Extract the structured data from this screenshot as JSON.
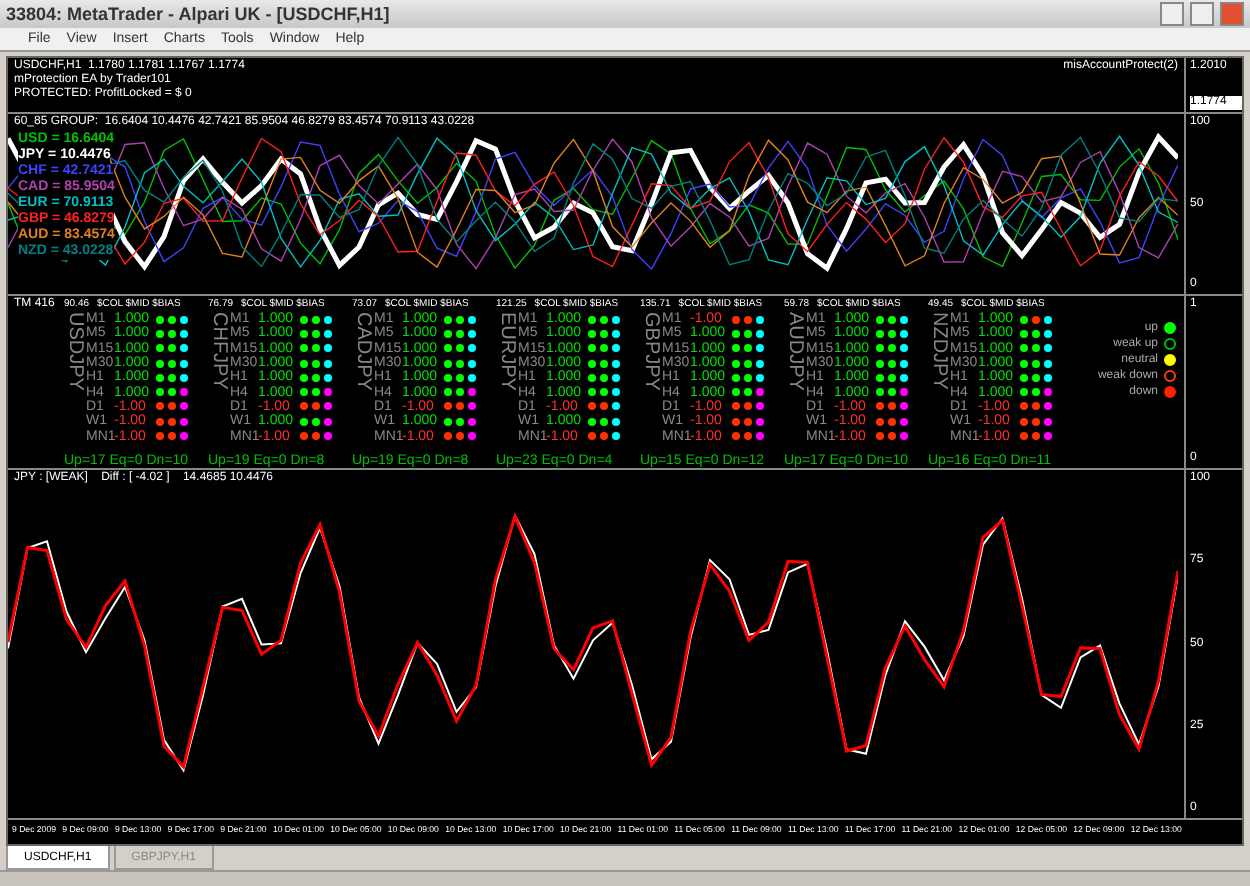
{
  "window": {
    "title": "33804: MetaTrader - Alpari UK - [USDCHF,H1]"
  },
  "menu": [
    "File",
    "View",
    "Insert",
    "Charts",
    "Tools",
    "Window",
    "Help"
  ],
  "price_panel": {
    "lines": [
      "USDCHF,H1  1.1780 1.1781 1.1767 1.1774",
      "mProtection EA by Trader101",
      "PROTECTED: ProfitLocked = $ 0"
    ],
    "indicator": "misAccountProtect(2)",
    "scale": [
      "1.2010",
      "1.1774"
    ]
  },
  "strength_panel": {
    "header": "60_85 GROUP:  16.6404 10.4476 42.7421 85.9504 46.8279 83.4574 70.9113 43.0228",
    "scale": [
      "100",
      "50",
      "0"
    ],
    "legend": [
      {
        "label": "USD = 16.6404",
        "color": "#00c000"
      },
      {
        "label": "JPY = 10.4476",
        "color": "#ffffff"
      },
      {
        "label": "CHF = 42.7421",
        "color": "#4040ff"
      },
      {
        "label": "CAD = 85.9504",
        "color": "#b040b0"
      },
      {
        "label": "EUR = 70.9113",
        "color": "#00c0c0"
      },
      {
        "label": "GBP = 46.8279",
        "color": "#ff2020"
      },
      {
        "label": "AUD = 83.4574",
        "color": "#e08020"
      },
      {
        "label": "NZD = 43.0228",
        "color": "#008080"
      }
    ]
  },
  "matrix_panel": {
    "label": "TM 416",
    "scale": [
      "1",
      "0"
    ],
    "pairs": [
      {
        "name": "USDJPY",
        "price": "90.46",
        "columns": "$COL $MID $BIAS",
        "summary": "Up=17 Eq=0 Dn=10",
        "rows": [
          {
            "tf": "M1",
            "value": "1.000",
            "dots": [
              {
                "color": "#00ff00"
              },
              {
                "color": "#00ff00"
              },
              {
                "color": "#00ffff"
              }
            ]
          },
          {
            "tf": "M5",
            "value": "1.000",
            "dots": [
              {
                "color": "#00ff00"
              },
              {
                "color": "#00ff00"
              },
              {
                "color": "#00ffff"
              }
            ]
          },
          {
            "tf": "M15",
            "value": "1.000",
            "dots": [
              {
                "color": "#00ff00"
              },
              {
                "color": "#00ff00"
              },
              {
                "color": "#00ffff"
              }
            ]
          },
          {
            "tf": "M30",
            "value": "1.000",
            "dots": [
              {
                "color": "#00ff00"
              },
              {
                "color": "#00ff00"
              },
              {
                "color": "#00ffff"
              }
            ]
          },
          {
            "tf": "H1",
            "value": "1.000",
            "dots": [
              {
                "color": "#00ff00"
              },
              {
                "color": "#00ff00"
              },
              {
                "color": "#00ffff"
              }
            ]
          },
          {
            "tf": "H4",
            "value": "1.000",
            "dots": [
              {
                "color": "#00ff00"
              },
              {
                "color": "#00ff00"
              },
              {
                "color": "#ff00ff"
              }
            ]
          },
          {
            "tf": "D1",
            "value": "-1.00",
            "dots": [
              {
                "color": "#ff3000"
              },
              {
                "color": "#ff3000"
              },
              {
                "color": "#ff00ff"
              }
            ]
          },
          {
            "tf": "W1",
            "value": "-1.00",
            "dots": [
              {
                "color": "#ff3000"
              },
              {
                "color": "#ff3000"
              },
              {
                "color": "#ff00ff"
              }
            ]
          },
          {
            "tf": "MN1",
            "value": "-1.00",
            "dots": [
              {
                "color": "#ff3000"
              },
              {
                "color": "#ff3000"
              },
              {
                "color": "#ff00ff"
              }
            ]
          }
        ]
      },
      {
        "name": "CHFJPY",
        "price": "76.79",
        "columns": "$COL $MID $BIAS",
        "summary": "Up=19 Eq=0 Dn=8",
        "rows": [
          {
            "tf": "M1",
            "value": "1.000",
            "dots": [
              {
                "color": "#00ff00"
              },
              {
                "color": "#00ff00"
              },
              {
                "color": "#00ffff"
              }
            ]
          },
          {
            "tf": "M5",
            "value": "1.000",
            "dots": [
              {
                "color": "#00ff00"
              },
              {
                "color": "#00ff00"
              },
              {
                "color": "#00ffff"
              }
            ]
          },
          {
            "tf": "M15",
            "value": "1.000",
            "dots": [
              {
                "color": "#00ff00"
              },
              {
                "color": "#00ff00"
              },
              {
                "color": "#00ffff"
              }
            ]
          },
          {
            "tf": "M30",
            "value": "1.000",
            "dots": [
              {
                "color": "#00ff00"
              },
              {
                "color": "#00ff00"
              },
              {
                "color": "#00ffff"
              }
            ]
          },
          {
            "tf": "H1",
            "value": "1.000",
            "dots": [
              {
                "color": "#00ff00"
              },
              {
                "color": "#00ff00"
              },
              {
                "color": "#00ffff"
              }
            ]
          },
          {
            "tf": "H4",
            "value": "1.000",
            "dots": [
              {
                "color": "#00ff00"
              },
              {
                "color": "#00ff00"
              },
              {
                "color": "#ff00ff"
              }
            ]
          },
          {
            "tf": "D1",
            "value": "-1.00",
            "dots": [
              {
                "color": "#ff3000"
              },
              {
                "color": "#ff3000"
              },
              {
                "color": "#ff00ff"
              }
            ]
          },
          {
            "tf": "W1",
            "value": "1.000",
            "dots": [
              {
                "color": "#00ff00"
              },
              {
                "color": "#00ff00"
              },
              {
                "color": "#ff00ff"
              }
            ]
          },
          {
            "tf": "MN1",
            "value": "-1.00",
            "dots": [
              {
                "color": "#ff3000"
              },
              {
                "color": "#ff3000"
              },
              {
                "color": "#ff00ff"
              }
            ]
          }
        ]
      },
      {
        "name": "CADJPY",
        "price": "73.07",
        "columns": "$COL $MID $BIAS",
        "summary": "Up=19 Eq=0 Dn=8",
        "rows": [
          {
            "tf": "M1",
            "value": "1.000",
            "dots": [
              {
                "color": "#00ff00"
              },
              {
                "color": "#00ff00"
              },
              {
                "color": "#00ffff"
              }
            ]
          },
          {
            "tf": "M5",
            "value": "1.000",
            "dots": [
              {
                "color": "#00ff00"
              },
              {
                "color": "#00ff00"
              },
              {
                "color": "#00ffff"
              }
            ]
          },
          {
            "tf": "M15",
            "value": "1.000",
            "dots": [
              {
                "color": "#00ff00"
              },
              {
                "color": "#00ff00"
              },
              {
                "color": "#00ffff"
              }
            ]
          },
          {
            "tf": "M30",
            "value": "1.000",
            "dots": [
              {
                "color": "#00ff00"
              },
              {
                "color": "#00ff00"
              },
              {
                "color": "#00ffff"
              }
            ]
          },
          {
            "tf": "H1",
            "value": "1.000",
            "dots": [
              {
                "color": "#00ff00"
              },
              {
                "color": "#00ff00"
              },
              {
                "color": "#00ffff"
              }
            ]
          },
          {
            "tf": "H4",
            "value": "1.000",
            "dots": [
              {
                "color": "#00ff00"
              },
              {
                "color": "#00ff00"
              },
              {
                "color": "#ff00ff"
              }
            ]
          },
          {
            "tf": "D1",
            "value": "-1.00",
            "dots": [
              {
                "color": "#ff3000"
              },
              {
                "color": "#ff3000"
              },
              {
                "color": "#ff00ff"
              }
            ]
          },
          {
            "tf": "W1",
            "value": "1.000",
            "dots": [
              {
                "color": "#00ff00"
              },
              {
                "color": "#00ff00"
              },
              {
                "color": "#ff00ff"
              }
            ]
          },
          {
            "tf": "MN1",
            "value": "-1.00",
            "dots": [
              {
                "color": "#ff3000"
              },
              {
                "color": "#ff3000"
              },
              {
                "color": "#ff00ff"
              }
            ]
          }
        ]
      },
      {
        "name": "EURJPY",
        "price": "121.25",
        "columns": "$COL $MID $BIAS",
        "summary": "Up=23 Eq=0 Dn=4",
        "rows": [
          {
            "tf": "M1",
            "value": "1.000",
            "dots": [
              {
                "color": "#00ff00"
              },
              {
                "color": "#00ff00"
              },
              {
                "color": "#00ffff"
              }
            ]
          },
          {
            "tf": "M5",
            "value": "1.000",
            "dots": [
              {
                "color": "#00ff00"
              },
              {
                "color": "#00ff00"
              },
              {
                "color": "#00ffff"
              }
            ]
          },
          {
            "tf": "M15",
            "value": "1.000",
            "dots": [
              {
                "color": "#00ff00"
              },
              {
                "color": "#00ff00"
              },
              {
                "color": "#00ffff"
              }
            ]
          },
          {
            "tf": "M30",
            "value": "1.000",
            "dots": [
              {
                "color": "#00ff00"
              },
              {
                "color": "#00ff00"
              },
              {
                "color": "#00ffff"
              }
            ]
          },
          {
            "tf": "H1",
            "value": "1.000",
            "dots": [
              {
                "color": "#00ff00"
              },
              {
                "color": "#00ff00"
              },
              {
                "color": "#00ffff"
              }
            ]
          },
          {
            "tf": "H4",
            "value": "1.000",
            "dots": [
              {
                "color": "#00ff00"
              },
              {
                "color": "#00ff00"
              },
              {
                "color": "#00ffff"
              }
            ]
          },
          {
            "tf": "D1",
            "value": "-1.00",
            "dots": [
              {
                "color": "#ff3000"
              },
              {
                "color": "#ff3000"
              },
              {
                "color": "#00ffff"
              }
            ]
          },
          {
            "tf": "W1",
            "value": "1.000",
            "dots": [
              {
                "color": "#00ff00"
              },
              {
                "color": "#00ff00"
              },
              {
                "color": "#00ffff"
              }
            ]
          },
          {
            "tf": "MN1",
            "value": "-1.00",
            "dots": [
              {
                "color": "#ff3000"
              },
              {
                "color": "#ff3000"
              },
              {
                "color": "#00ffff"
              }
            ]
          }
        ]
      },
      {
        "name": "GBPJPY",
        "price": "135.71",
        "columns": "$COL $MID $BIAS",
        "summary": "Up=15 Eq=0 Dn=12",
        "rows": [
          {
            "tf": "M1",
            "value": "-1.00",
            "dots": [
              {
                "color": "#ff3000"
              },
              {
                "color": "#ff3000"
              },
              {
                "color": "#00ffff"
              }
            ]
          },
          {
            "tf": "M5",
            "value": "1.000",
            "dots": [
              {
                "color": "#00ff00"
              },
              {
                "color": "#00ff00"
              },
              {
                "color": "#00ffff"
              }
            ]
          },
          {
            "tf": "M15",
            "value": "1.000",
            "dots": [
              {
                "color": "#00ff00"
              },
              {
                "color": "#00ff00"
              },
              {
                "color": "#00ffff"
              }
            ]
          },
          {
            "tf": "M30",
            "value": "1.000",
            "dots": [
              {
                "color": "#00ff00"
              },
              {
                "color": "#00ff00"
              },
              {
                "color": "#00ffff"
              }
            ]
          },
          {
            "tf": "H1",
            "value": "1.000",
            "dots": [
              {
                "color": "#00ff00"
              },
              {
                "color": "#00ff00"
              },
              {
                "color": "#00ffff"
              }
            ]
          },
          {
            "tf": "H4",
            "value": "1.000",
            "dots": [
              {
                "color": "#00ff00"
              },
              {
                "color": "#00ff00"
              },
              {
                "color": "#ff00ff"
              }
            ]
          },
          {
            "tf": "D1",
            "value": "-1.00",
            "dots": [
              {
                "color": "#ff3000"
              },
              {
                "color": "#ff3000"
              },
              {
                "color": "#ff00ff"
              }
            ]
          },
          {
            "tf": "W1",
            "value": "-1.00",
            "dots": [
              {
                "color": "#ff3000"
              },
              {
                "color": "#ff3000"
              },
              {
                "color": "#ff00ff"
              }
            ]
          },
          {
            "tf": "MN1",
            "value": "-1.00",
            "dots": [
              {
                "color": "#ff3000"
              },
              {
                "color": "#ff3000"
              },
              {
                "color": "#ff00ff"
              }
            ]
          }
        ]
      },
      {
        "name": "AUDJPY",
        "price": "59.78",
        "columns": "$COL $MID $BIAS",
        "summary": "Up=17 Eq=0 Dn=10",
        "rows": [
          {
            "tf": "M1",
            "value": "1.000",
            "dots": [
              {
                "color": "#00ff00"
              },
              {
                "color": "#00ff00"
              },
              {
                "color": "#00ffff"
              }
            ]
          },
          {
            "tf": "M5",
            "value": "1.000",
            "dots": [
              {
                "color": "#00ff00"
              },
              {
                "color": "#00ff00"
              },
              {
                "color": "#00ffff"
              }
            ]
          },
          {
            "tf": "M15",
            "value": "1.000",
            "dots": [
              {
                "color": "#00ff00"
              },
              {
                "color": "#00ff00"
              },
              {
                "color": "#00ffff"
              }
            ]
          },
          {
            "tf": "M30",
            "value": "1.000",
            "dots": [
              {
                "color": "#00ff00"
              },
              {
                "color": "#00ff00"
              },
              {
                "color": "#00ffff"
              }
            ]
          },
          {
            "tf": "H1",
            "value": "1.000",
            "dots": [
              {
                "color": "#00ff00"
              },
              {
                "color": "#00ff00"
              },
              {
                "color": "#00ffff"
              }
            ]
          },
          {
            "tf": "H4",
            "value": "1.000",
            "dots": [
              {
                "color": "#00ff00"
              },
              {
                "color": "#00ff00"
              },
              {
                "color": "#ff00ff"
              }
            ]
          },
          {
            "tf": "D1",
            "value": "-1.00",
            "dots": [
              {
                "color": "#ff3000"
              },
              {
                "color": "#ff3000"
              },
              {
                "color": "#ff00ff"
              }
            ]
          },
          {
            "tf": "W1",
            "value": "-1.00",
            "dots": [
              {
                "color": "#ff3000"
              },
              {
                "color": "#ff3000"
              },
              {
                "color": "#ff00ff"
              }
            ]
          },
          {
            "tf": "MN1",
            "value": "-1.00",
            "dots": [
              {
                "color": "#ff3000"
              },
              {
                "color": "#ff3000"
              },
              {
                "color": "#ff00ff"
              }
            ]
          }
        ]
      },
      {
        "name": "NZDJPY",
        "price": "49.45",
        "columns": "$COL $MID $BIAS",
        "summary": "Up=16 Eq=0 Dn=11",
        "rows": [
          {
            "tf": "M1",
            "value": "1.000",
            "dots": [
              {
                "color": "#00ff00"
              },
              {
                "color": "#ff3000"
              },
              {
                "color": "#00ffff"
              }
            ]
          },
          {
            "tf": "M5",
            "value": "1.000",
            "dots": [
              {
                "color": "#00ff00"
              },
              {
                "color": "#00ff00"
              },
              {
                "color": "#00ffff"
              }
            ]
          },
          {
            "tf": "M15",
            "value": "1.000",
            "dots": [
              {
                "color": "#00ff00"
              },
              {
                "color": "#00ff00"
              },
              {
                "color": "#00ffff"
              }
            ]
          },
          {
            "tf": "M30",
            "value": "1.000",
            "dots": [
              {
                "color": "#00ff00"
              },
              {
                "color": "#00ff00"
              },
              {
                "color": "#00ffff"
              }
            ]
          },
          {
            "tf": "H1",
            "value": "1.000",
            "dots": [
              {
                "color": "#00ff00"
              },
              {
                "color": "#00ff00"
              },
              {
                "color": "#00ffff"
              }
            ]
          },
          {
            "tf": "H4",
            "value": "1.000",
            "dots": [
              {
                "color": "#00ff00"
              },
              {
                "color": "#00ff00"
              },
              {
                "color": "#ff00ff"
              }
            ]
          },
          {
            "tf": "D1",
            "value": "-1.00",
            "dots": [
              {
                "color": "#ff3000"
              },
              {
                "color": "#ff3000"
              },
              {
                "color": "#ff00ff"
              }
            ]
          },
          {
            "tf": "W1",
            "value": "-1.00",
            "dots": [
              {
                "color": "#ff3000"
              },
              {
                "color": "#ff3000"
              },
              {
                "color": "#ff00ff"
              }
            ]
          },
          {
            "tf": "MN1",
            "value": "-1.00",
            "dots": [
              {
                "color": "#ff3000"
              },
              {
                "color": "#ff3000"
              },
              {
                "color": "#ff00ff"
              }
            ]
          }
        ]
      }
    ],
    "legend": [
      {
        "label": "up",
        "kind": "fill",
        "color": "#00ff00"
      },
      {
        "label": "weak up",
        "kind": "ring",
        "color": "#00c000"
      },
      {
        "label": "neutral",
        "kind": "fill",
        "color": "#ffff00"
      },
      {
        "label": "weak down",
        "kind": "ring",
        "color": "#ff4000"
      },
      {
        "label": "down",
        "kind": "fill",
        "color": "#ff2000"
      }
    ]
  },
  "jpy_panel": {
    "header": "JPY : [WEAK]    Diff : [ -4.02 ]    14.4685 10.4476",
    "scale": [
      "100",
      "75",
      "50",
      "25",
      "0"
    ]
  },
  "time_axis": [
    "9 Dec 2009",
    "9 Dec 09:00",
    "9 Dec 13:00",
    "9 Dec 17:00",
    "9 Dec 21:00",
    "10 Dec 01:00",
    "10 Dec 05:00",
    "10 Dec 09:00",
    "10 Dec 13:00",
    "10 Dec 17:00",
    "10 Dec 21:00",
    "11 Dec 01:00",
    "11 Dec 05:00",
    "11 Dec 09:00",
    "11 Dec 13:00",
    "11 Dec 17:00",
    "11 Dec 21:00",
    "12 Dec 01:00",
    "12 Dec 05:00",
    "12 Dec 09:00",
    "12 Dec 13:00"
  ],
  "chart_tabs": [
    {
      "label": "USDCHF,H1",
      "selected": true
    },
    {
      "label": "GBPJPY,H1",
      "selected": false
    }
  ]
}
